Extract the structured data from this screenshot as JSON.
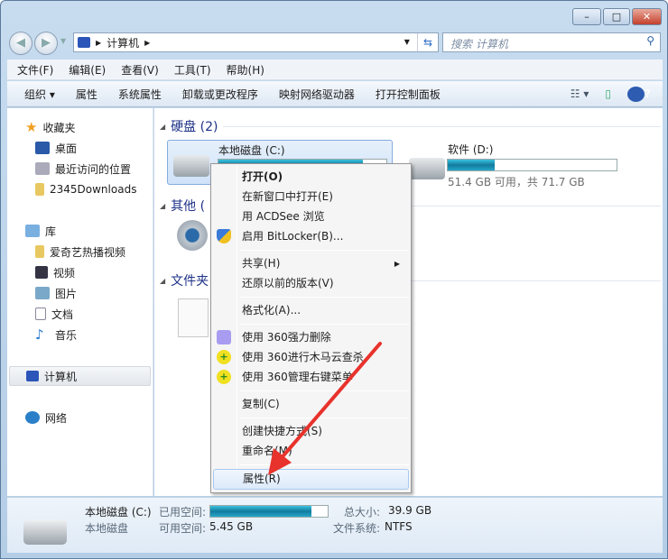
{
  "window": {
    "minimize": "–",
    "maximize": "□",
    "close": "✕"
  },
  "address": {
    "path": "计算机",
    "search_placeholder": "搜索 计算机"
  },
  "menubar": [
    "文件(F)",
    "编辑(E)",
    "查看(V)",
    "工具(T)",
    "帮助(H)"
  ],
  "toolbar": [
    "组织 ▾",
    "属性",
    "系统属性",
    "卸载或更改程序",
    "映射网络驱动器",
    "打开控制面板"
  ],
  "sidebar": {
    "favorites": {
      "label": "收藏夹",
      "items": [
        "桌面",
        "最近访问的位置",
        "2345Downloads"
      ]
    },
    "libraries": {
      "label": "库",
      "items": [
        "爱奇艺热播视频",
        "视频",
        "图片",
        "文档",
        "音乐"
      ]
    },
    "computer": "计算机",
    "network": "网络"
  },
  "groups": {
    "hdd": "硬盘 (2)",
    "other": "其他 (",
    "folders": "文件夹"
  },
  "drives": [
    {
      "name": "本地磁盘 (C:)",
      "used_fraction": 0.86
    },
    {
      "name": "软件 (D:)",
      "used_fraction": 0.28,
      "info": "51.4 GB 可用，共 71.7 GB"
    }
  ],
  "context_menu": [
    {
      "label": "打开(O)",
      "bold": true
    },
    {
      "label": "在新窗口中打开(E)"
    },
    {
      "label": "用 ACDSee 浏览"
    },
    {
      "label": "启用 BitLocker(B)...",
      "icon": "shield-icon"
    },
    {
      "label": "共享(H)",
      "submenu": true
    },
    {
      "label": "还原以前的版本(V)"
    },
    {
      "label": "格式化(A)..."
    },
    {
      "label": "使用 360强力删除",
      "icon": "360-delete-icon"
    },
    {
      "label": "使用 360进行木马云查杀",
      "icon": "360-scan-icon"
    },
    {
      "label": "使用 360管理右键菜单",
      "icon": "360-menu-icon"
    },
    {
      "label": "复制(C)"
    },
    {
      "label": "创建快捷方式(S)"
    },
    {
      "label": "重命名(M)"
    },
    {
      "label": "属性(R)",
      "highlighted": true
    }
  ],
  "details": {
    "name": "本地磁盘 (C:)",
    "type": "本地磁盘",
    "used_label": "已用空间:",
    "used_fraction": 0.86,
    "free_label": "可用空间:",
    "free": "5.45 GB",
    "total_label": "总大小:",
    "total": "39.9 GB",
    "fs_label": "文件系统:",
    "fs": "NTFS"
  },
  "colors": {
    "accent": "#1e3287",
    "arrow": "#e8322c",
    "bar": "#26a7c9"
  }
}
